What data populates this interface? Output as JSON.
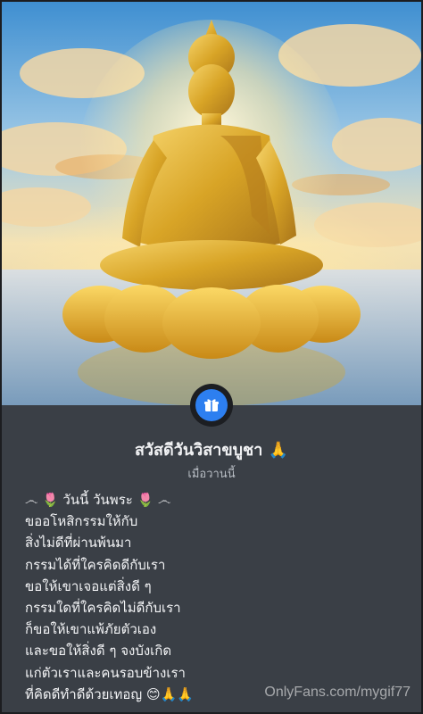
{
  "post": {
    "title": "สวัสดีวันวิสาขบูชา 🙏",
    "timestamp": "เมื่อวานนี้",
    "lines": [
      "෴ 🌷 วันนี้ วันพระ 🌷 ෴",
      "ขออโหสิกรรมให้กับ",
      "สิ่งไม่ดีที่ผ่านพ้นมา",
      "กรรมได้ที่ใครคิดดีกับเรา",
      "ขอให้เขาเจอแต่สิ่งดี ๆ",
      "กรรมใดที่ใครคิดไม่ดีกับเรา",
      "ก็ขอให้เขาแพ้ภัยตัวเอง",
      "และขอให้สิ่งดี ๆ จงบังเกิด",
      "แก่ตัวเราและคนรอบข้างเรา",
      "ที่คิดดีทำดีด้วยเทอญ 😊🙏🙏"
    ]
  },
  "badge_icon": "gift-icon",
  "watermark": "OnlyFans.com/mygif77",
  "colors": {
    "card_bg": "#3a3f46",
    "badge_blue": "#2d7ff0",
    "gold": "#d9a520"
  }
}
